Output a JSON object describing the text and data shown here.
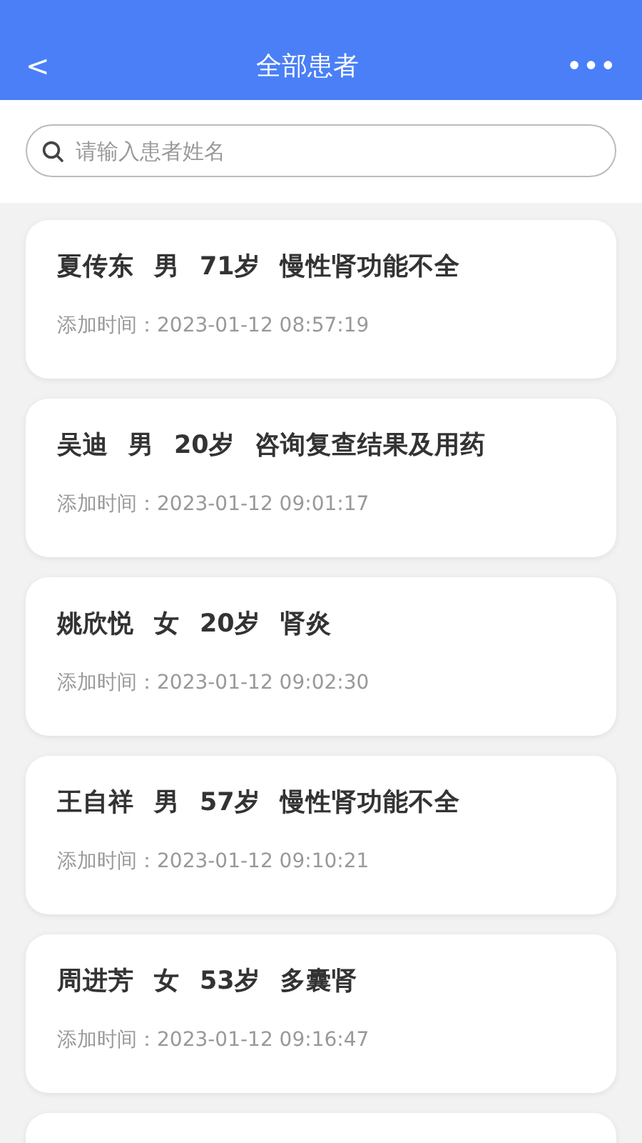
{
  "header": {
    "back": "<",
    "title": "全部患者",
    "more": "•••"
  },
  "search": {
    "placeholder": "请输入患者姓名"
  },
  "patients": [
    {
      "name": "夏传东",
      "sex": "男",
      "age": "71岁",
      "diagnosis": "慢性肾功能不全",
      "added": "添加时间：2023-01-12 08:57:19"
    },
    {
      "name": "吴迪",
      "sex": "男",
      "age": "20岁",
      "diagnosis": "咨询复查结果及用药",
      "added": "添加时间：2023-01-12 09:01:17"
    },
    {
      "name": "姚欣悦",
      "sex": "女",
      "age": "20岁",
      "diagnosis": "肾炎",
      "added": "添加时间：2023-01-12 09:02:30"
    },
    {
      "name": "王自祥",
      "sex": "男",
      "age": "57岁",
      "diagnosis": "慢性肾功能不全",
      "added": "添加时间：2023-01-12 09:10:21"
    },
    {
      "name": "周进芳",
      "sex": "女",
      "age": "53岁",
      "diagnosis": "多囊肾",
      "added": "添加时间：2023-01-12 09:16:47"
    }
  ]
}
